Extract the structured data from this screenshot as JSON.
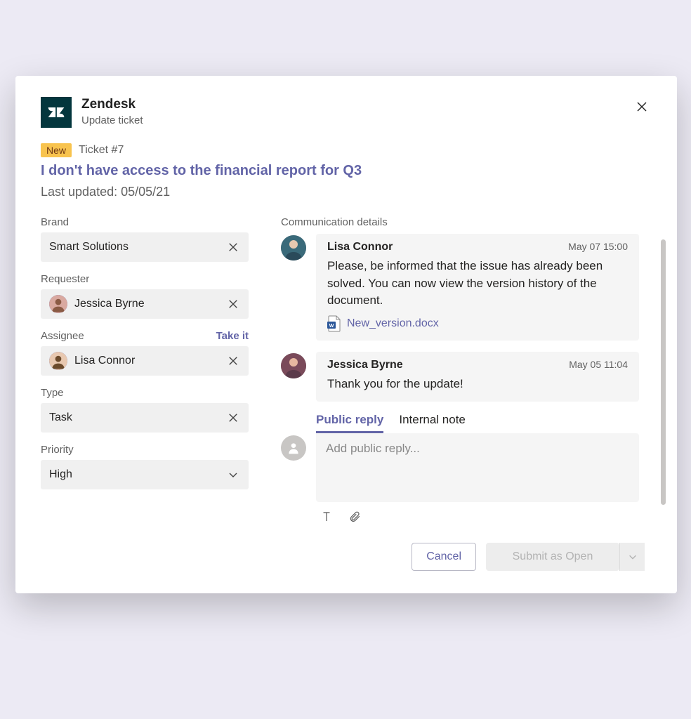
{
  "header": {
    "app_name": "Zendesk",
    "subtitle": "Update ticket"
  },
  "ticket": {
    "badge": "New",
    "number": "Ticket #7",
    "title": "I don't have access to the financial report for Q3",
    "last_updated": "Last updated: 05/05/21"
  },
  "fields": {
    "brand": {
      "label": "Brand",
      "value": "Smart Solutions"
    },
    "requester": {
      "label": "Requester",
      "value": "Jessica Byrne"
    },
    "assignee": {
      "label": "Assignee",
      "value": "Lisa Connor",
      "take_it": "Take it"
    },
    "type": {
      "label": "Type",
      "value": "Task"
    },
    "priority": {
      "label": "Priority",
      "value": "High"
    }
  },
  "comm": {
    "section_title": "Communication details",
    "messages": [
      {
        "author": "Lisa Connor",
        "time": "May 07 15:00",
        "body": "Please, be informed that the issue has already been solved. You can now view the version history of the document.",
        "attachment": "New_version.docx"
      },
      {
        "author": "Jessica Byrne",
        "time": "May 05 11:04",
        "body": "Thank you for the update!"
      }
    ],
    "tabs": {
      "public": "Public reply",
      "internal": "Internal note"
    },
    "reply_placeholder": "Add public reply..."
  },
  "footer": {
    "cancel": "Cancel",
    "submit": "Submit as Open"
  }
}
